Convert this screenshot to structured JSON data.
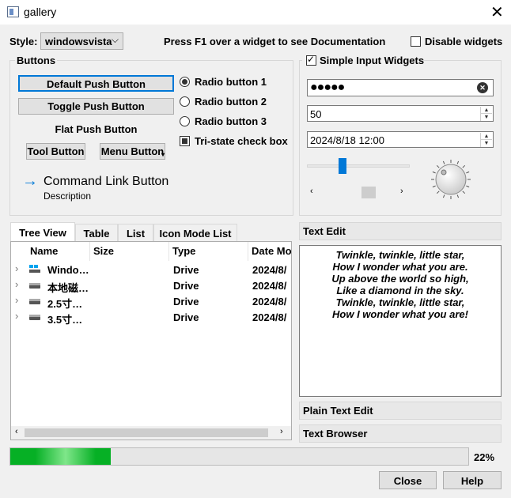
{
  "window": {
    "title": "gallery",
    "close_glyph": "✕"
  },
  "style_row": {
    "label": "Style:",
    "selected": "windowsvista",
    "f1_text": "Press F1 over a widget to see Documentation",
    "disable_label": "Disable widgets",
    "disable_checked": false
  },
  "buttons_group": {
    "title": "Buttons",
    "default_push": "Default Push Button",
    "toggle_push": "Toggle Push Button",
    "flat_push": "Flat Push Button",
    "tool_button": "Tool Button",
    "menu_button": "Menu Button",
    "command_link": "Command Link Button",
    "command_desc": "Description",
    "radio1": "Radio button 1",
    "radio2": "Radio button 2",
    "radio3": "Radio button 3",
    "tristate": "Tri-state check box"
  },
  "input_group": {
    "title": "Simple Input Widgets",
    "checked": true,
    "password": "●●●●●",
    "spin_value": "50",
    "datetime": "2024/8/18 12:00",
    "slider_value_fraction": 0.33,
    "hscroll_value_fraction": 0.55
  },
  "tabs": [
    {
      "label": "Tree View",
      "active": true
    },
    {
      "label": "Table"
    },
    {
      "label": "List"
    },
    {
      "label": "Icon Mode List"
    }
  ],
  "tree": {
    "columns": [
      "Name",
      "Size",
      "Type",
      "Date Mo"
    ],
    "rows": [
      {
        "name": "Windo…",
        "size": "",
        "type": "Drive",
        "date": "2024/8/"
      },
      {
        "name": "本地磁…",
        "size": "",
        "type": "Drive",
        "date": "2024/8/"
      },
      {
        "name": "2.5寸…",
        "size": "",
        "type": "Drive",
        "date": "2024/8/"
      },
      {
        "name": "3.5寸…",
        "size": "",
        "type": "Drive",
        "date": "2024/8/"
      }
    ]
  },
  "text_panels": {
    "text_edit": "Text Edit",
    "plain_text_edit": "Plain Text Edit",
    "text_browser": "Text Browser",
    "poem": [
      "Twinkle, twinkle, little star,",
      "How I wonder what you are.",
      "Up above the world so high,",
      "Like a diamond in the sky.",
      "Twinkle, twinkle, little star,",
      "How I wonder what you are!"
    ]
  },
  "progress": {
    "value_percent": 22,
    "label": "22%"
  },
  "dialog": {
    "close": "Close",
    "help": "Help"
  },
  "colors": {
    "accent": "#0078d7",
    "progress": "#06b025",
    "arrow": "#0078d7"
  }
}
